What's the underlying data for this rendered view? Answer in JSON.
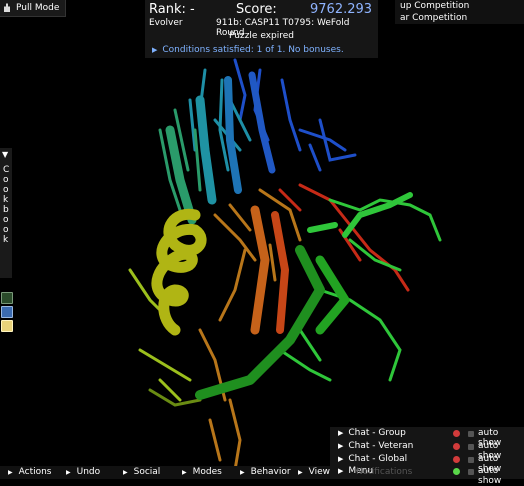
{
  "pull_mode": {
    "label": "Pull Mode"
  },
  "score_panel": {
    "rank_label": "Rank: -",
    "score_label": "Score:",
    "score_value": "9762.293",
    "role": "Evolver",
    "puzzle_title": "911b: CASP11 T0795: WeFold Round",
    "status": "Puzzle expired",
    "conditions": "Conditions satisfied: 1 of 1. No bonuses."
  },
  "competitions": [
    "up Competition",
    "ar Competition"
  ],
  "cookbook": {
    "label": "Cookbook",
    "arrow": "▼"
  },
  "chat": [
    {
      "label": "Chat - Group",
      "indicator": "#d23b3b",
      "auto": "auto show"
    },
    {
      "label": "Chat - Veteran",
      "indicator": "#d23b3b",
      "auto": "auto show"
    },
    {
      "label": "Chat - Global",
      "indicator": "#d23b3b",
      "auto": "auto show"
    },
    {
      "label": "Menu",
      "indicator": "#5ad84a",
      "auto": "auto show"
    }
  ],
  "bottom_menu": [
    {
      "label": "Actions"
    },
    {
      "label": "Undo"
    },
    {
      "label": "Social"
    },
    {
      "label": "Modes"
    },
    {
      "label": "Behavior"
    },
    {
      "label": "View"
    },
    {
      "label": "Notifications"
    }
  ],
  "colors": {
    "accent_blue": "#8fb4ff",
    "conditions_blue": "#7fb2ff",
    "panel": "#191919",
    "background": "#000000"
  }
}
